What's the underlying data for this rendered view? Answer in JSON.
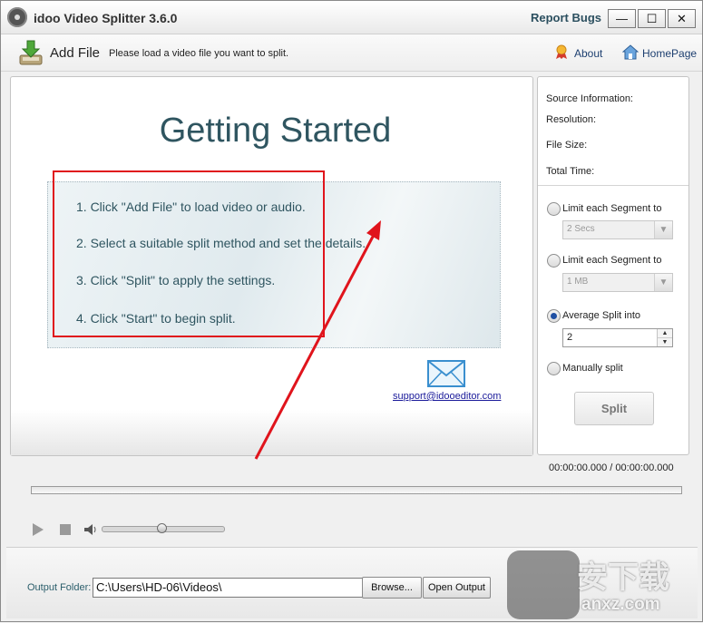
{
  "window": {
    "title": "idoo Video Splitter 3.6.0",
    "report_bugs": "Report Bugs",
    "min_glyph": "—",
    "max_glyph": "☐",
    "close_glyph": "✕"
  },
  "toolbar": {
    "add_file": "Add File",
    "hint": "Please load a video file you want to split.",
    "about": "About",
    "homepage": "HomePage"
  },
  "preview": {
    "heading": "Getting Started",
    "steps": [
      "1. Click \"Add File\" to load video or audio.",
      "2. Select a suitable split method and set the details.",
      "3. Click \"Split\" to apply the settings.",
      "4. Click \"Start\" to begin split."
    ],
    "support_email": "support@idooeditor.com"
  },
  "settings": {
    "source_info": "Source Information:",
    "resolution": "Resolution:",
    "file_size": "File Size:",
    "total_time": "Total Time:",
    "options": [
      {
        "label": "Limit each Segment to",
        "value": "2 Secs",
        "checked": false
      },
      {
        "label": "Limit each Segment to",
        "value": "1 MB",
        "checked": false
      },
      {
        "label": "Average Split into",
        "value": "2",
        "checked": true
      },
      {
        "label": "Manually split",
        "checked": false
      }
    ],
    "split_button": "Split"
  },
  "player": {
    "timecode": "00:00:00.000 / 00:00:00.000",
    "volume": 0.5
  },
  "output": {
    "label": "Output Folder:",
    "path": "C:\\Users\\HD-06\\Videos\\",
    "browse": "Browse...",
    "open_output": "Open Output"
  },
  "watermark": {
    "text1": "安下载",
    "text2": "anxz.com"
  },
  "colors": {
    "accent": "#2f5560",
    "annotation_red": "#e0141c",
    "link": "#1a1a9a"
  }
}
